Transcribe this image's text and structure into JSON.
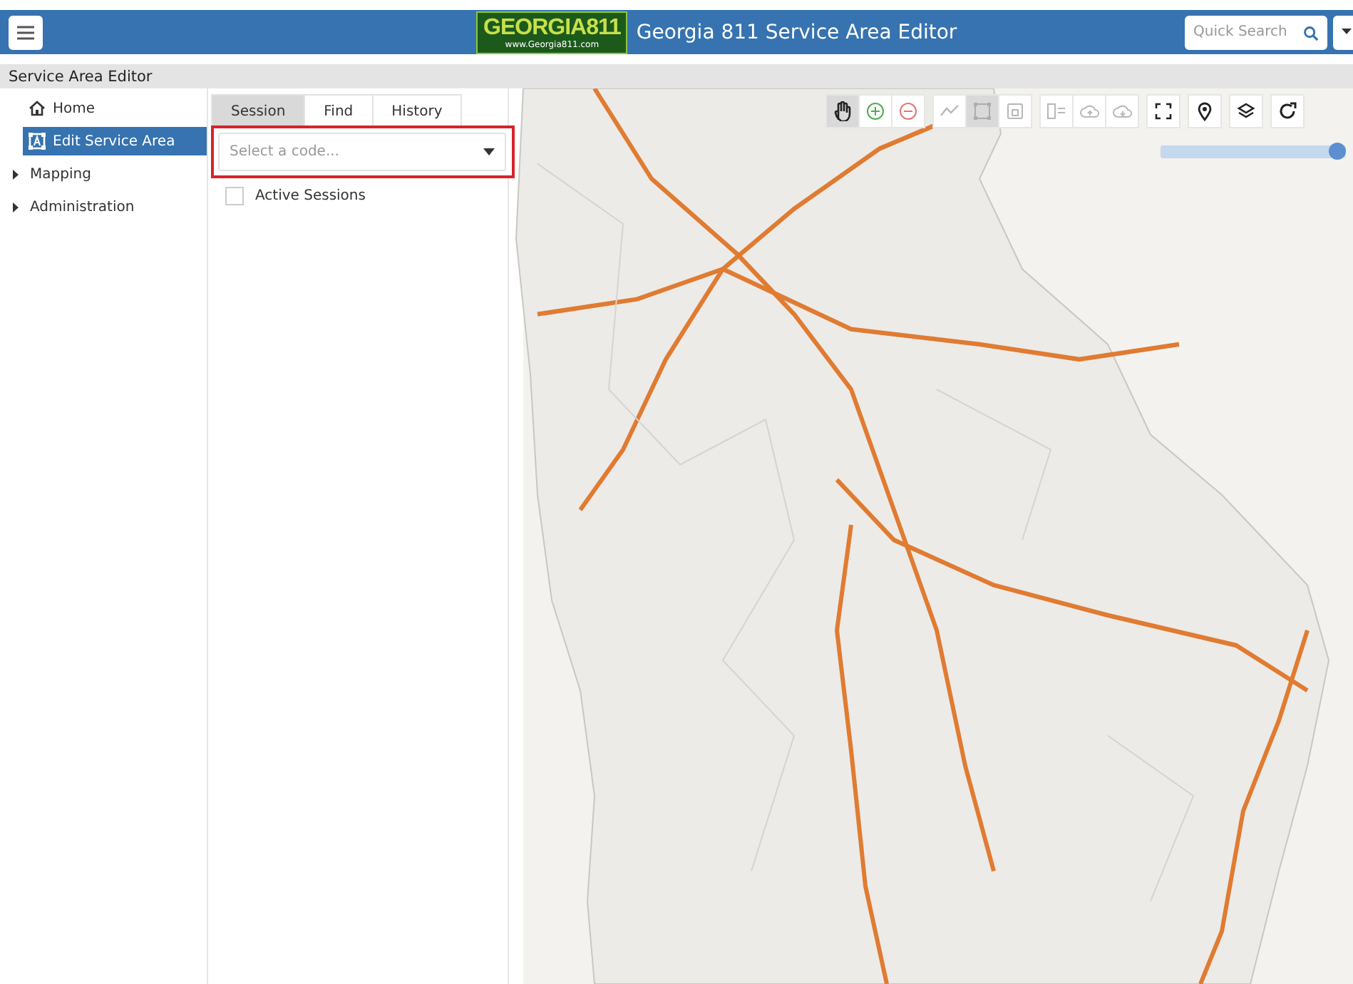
{
  "header": {
    "logo": {
      "main": "GEORGIA811",
      "sub": "www.Georgia811.com"
    },
    "title": "Georgia 811 Service Area Editor",
    "search": {
      "placeholder": "Quick Search"
    }
  },
  "breadcrumb": "Service Area Editor",
  "sidebar": {
    "items": [
      {
        "label": "Home",
        "kind": "link",
        "selected": false
      },
      {
        "label": "Edit Service Area",
        "kind": "link",
        "selected": true
      },
      {
        "label": "Mapping",
        "kind": "group",
        "expanded": false,
        "selected": false
      },
      {
        "label": "Administration",
        "kind": "group",
        "expanded": false,
        "selected": false
      }
    ]
  },
  "panel": {
    "tabs": [
      {
        "label": "Session",
        "selected": true
      },
      {
        "label": "Find",
        "selected": false
      },
      {
        "label": "History",
        "selected": false
      }
    ],
    "code_select": {
      "placeholder": "Select a code..."
    },
    "active_sessions": {
      "label": "Active Sessions",
      "checked": false
    }
  },
  "toolbar": [
    {
      "selected": true,
      "disabled": false
    },
    {
      "selected": false,
      "disabled": false
    },
    {
      "selected": false,
      "disabled": false
    },
    {
      "selected": false,
      "disabled": true
    },
    {
      "selected": true,
      "disabled": true
    },
    {
      "selected": false,
      "disabled": true
    },
    {
      "selected": false,
      "disabled": true
    },
    {
      "selected": false,
      "disabled": true
    },
    {
      "selected": false,
      "disabled": true
    },
    {
      "selected": false,
      "disabled": false
    },
    {
      "selected": false,
      "disabled": false
    },
    {
      "selected": false,
      "disabled": false
    },
    {
      "selected": false,
      "disabled": false
    }
  ],
  "opacity_slider": {
    "level": 0.95
  }
}
